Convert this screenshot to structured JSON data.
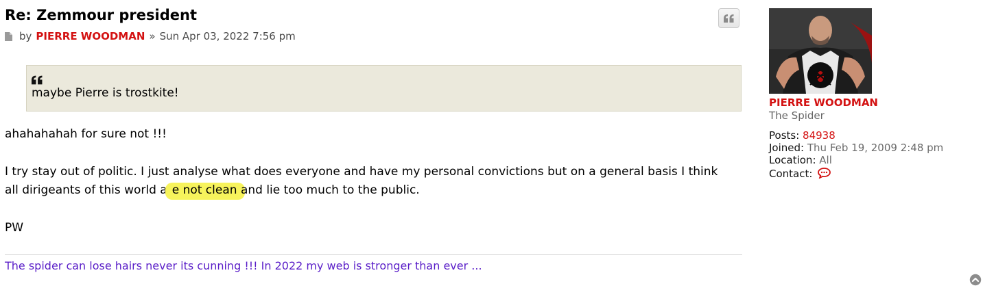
{
  "post": {
    "title": "Re: Zemmour president",
    "by_label": "by",
    "author": "PIERRE WOODMAN",
    "separator": "»",
    "date": "Sun Apr 03, 2022 7:56 pm",
    "quote_text": "maybe Pierre is trostkite!",
    "line1": "ahahahahah for sure not !!!",
    "para_a": "I try stay out of politic. I just analyse what does everyone and have my personal convictions but on a general basis I think",
    "para_b_start": "all dirigeants of this world ar",
    "para_b_highlight": "e not clean ",
    "para_b_end": "and lie too much to the public.",
    "signoff": "PW",
    "signature": "The spider can lose hairs never its cunning !!! In 2022 my web is stronger than ever ..."
  },
  "profile": {
    "username": "PIERRE WOODMAN",
    "rank": "The Spider",
    "posts_label": "Posts:",
    "posts_value": "84938",
    "joined_label": "Joined:",
    "joined_value": "Thu Feb 19, 2009 2:48 pm",
    "location_label": "Location:",
    "location_value": "All",
    "contact_label": "Contact:"
  },
  "colors": {
    "author_red": "#d31111",
    "signature_purple": "#5a1ec8",
    "quote_bg": "#ebe9dc",
    "highlight": "#f7f35c"
  },
  "icons": {
    "post": "document-icon",
    "quote": "quote-icon",
    "contact": "chat-bubble-icon",
    "top": "arrow-up-circle-icon"
  }
}
